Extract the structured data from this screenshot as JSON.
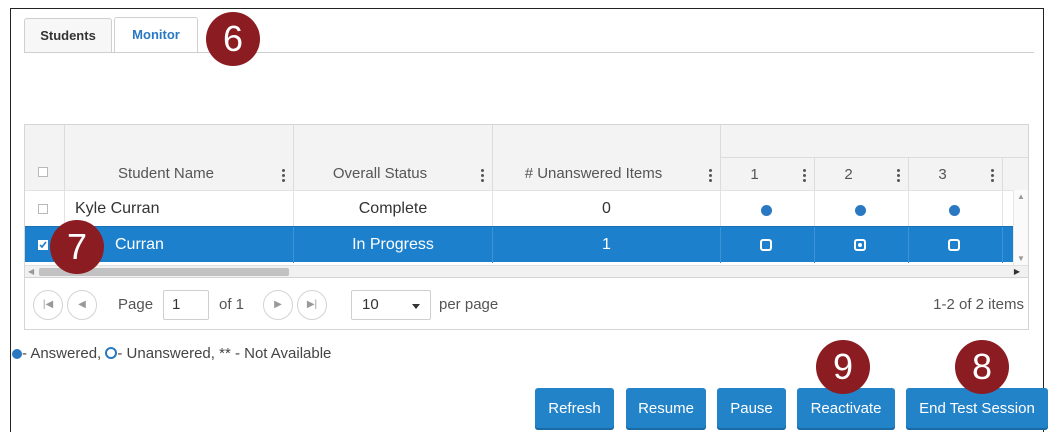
{
  "tabs": [
    {
      "label": "Students",
      "active": false
    },
    {
      "label": "Monitor",
      "active": true
    }
  ],
  "grid": {
    "columns": {
      "student_name": "Student Name",
      "overall_status": "Overall Status",
      "unanswered": "# Unanswered Items",
      "items": [
        "1",
        "2",
        "3"
      ]
    },
    "rows": [
      {
        "name": "Kyle Curran",
        "status": "Complete",
        "unanswered": "0",
        "selected": false,
        "items": [
          "answered",
          "answered",
          "answered"
        ]
      },
      {
        "name": "Curran",
        "status": "In Progress",
        "unanswered": "1",
        "selected": true,
        "items": [
          "unanswered",
          "answered-selected",
          "unanswered"
        ]
      }
    ]
  },
  "pager": {
    "page_label": "Page",
    "page_value": "1",
    "of_label": "of 1",
    "page_size": "10",
    "per_page_label": "per page",
    "summary": "1-2 of 2 items"
  },
  "legend": {
    "answered": "- Answered,",
    "unanswered": "- Unanswered,",
    "not_available": "** - Not Available"
  },
  "buttons": {
    "refresh": "Refresh",
    "resume": "Resume",
    "pause": "Pause",
    "reactivate": "Reactivate",
    "end_session": "End Test Session"
  },
  "callouts": [
    "6",
    "7",
    "8",
    "9"
  ],
  "colors": {
    "accent": "#2383c9",
    "selected_row": "#1d80cc",
    "callout": "#8b1c22",
    "active_tab_text": "#2a78c2"
  }
}
